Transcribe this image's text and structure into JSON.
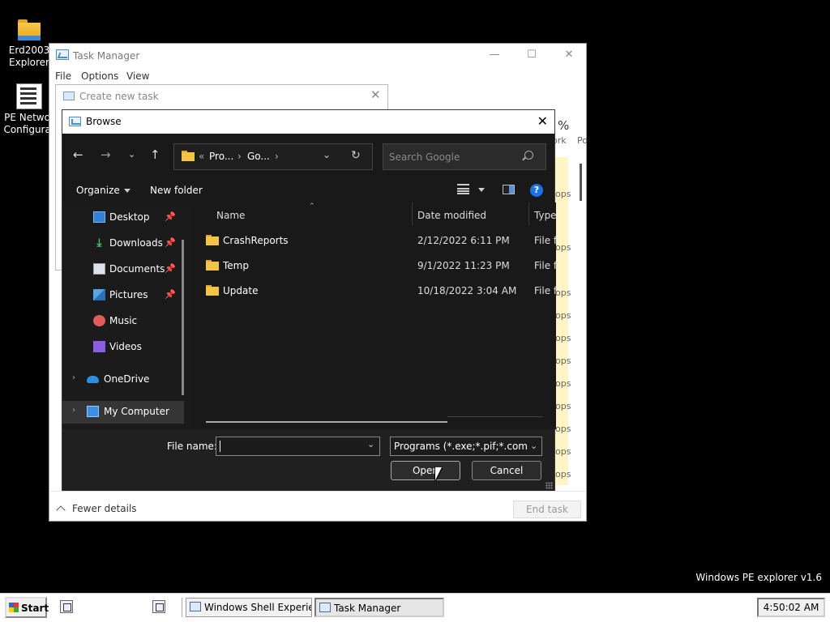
{
  "desktop": {
    "icons": [
      {
        "label_line1": "Erd2003",
        "label_line2": "Explorer"
      },
      {
        "label_line1": "PE Networ",
        "label_line2": "Configurat"
      }
    ],
    "brand": "Windows PE explorer v1.6"
  },
  "task_manager": {
    "title": "Task Manager",
    "menu": [
      "File",
      "Options",
      "View"
    ],
    "percent": "%",
    "col_network": "ork",
    "col_power": "Po",
    "row_values": [
      "ops",
      "ops",
      "ops",
      "ops",
      "ops",
      "ops",
      "ops",
      "ops",
      "ops",
      "ops",
      "ops",
      "ops"
    ],
    "fewer_details": "Fewer details",
    "end_task": "End task"
  },
  "create_task": {
    "title": "Create new task"
  },
  "browse": {
    "title": "Browse",
    "address": {
      "ellipsis": "«",
      "seg1": "Pro...",
      "seg2": "Go..."
    },
    "search_placeholder": "Search Google",
    "organize": "Organize",
    "new_folder": "New folder",
    "nav": [
      {
        "label": "Desktop",
        "pinned": true
      },
      {
        "label": "Downloads",
        "pinned": true
      },
      {
        "label": "Documents",
        "pinned": true
      },
      {
        "label": "Pictures",
        "pinned": true
      },
      {
        "label": "Music",
        "pinned": false
      },
      {
        "label": "Videos",
        "pinned": false
      },
      {
        "label": "OneDrive",
        "pinned": false
      },
      {
        "label": "My Computer",
        "pinned": false
      }
    ],
    "columns": {
      "name": "Name",
      "date": "Date modified",
      "type": "Type"
    },
    "files": [
      {
        "name": "CrashReports",
        "date": "2/12/2022 6:11 PM",
        "type": "File folder"
      },
      {
        "name": "Temp",
        "date": "9/1/2022 11:23 PM",
        "type": "File folder"
      },
      {
        "name": "Update",
        "date": "10/18/2022 3:04 AM",
        "type": "File folder"
      }
    ],
    "file_name_label": "File name:",
    "file_name_value": "",
    "file_type": "Programs (*.exe;*.pif;*.com;*.bat;*.cmd)",
    "open_label": "Open",
    "cancel_label": "Cancel"
  },
  "taskbar": {
    "start": "Start",
    "tasks": [
      "Windows Shell Experienc...",
      "Task Manager"
    ],
    "clock": "4:50:02 AM"
  }
}
